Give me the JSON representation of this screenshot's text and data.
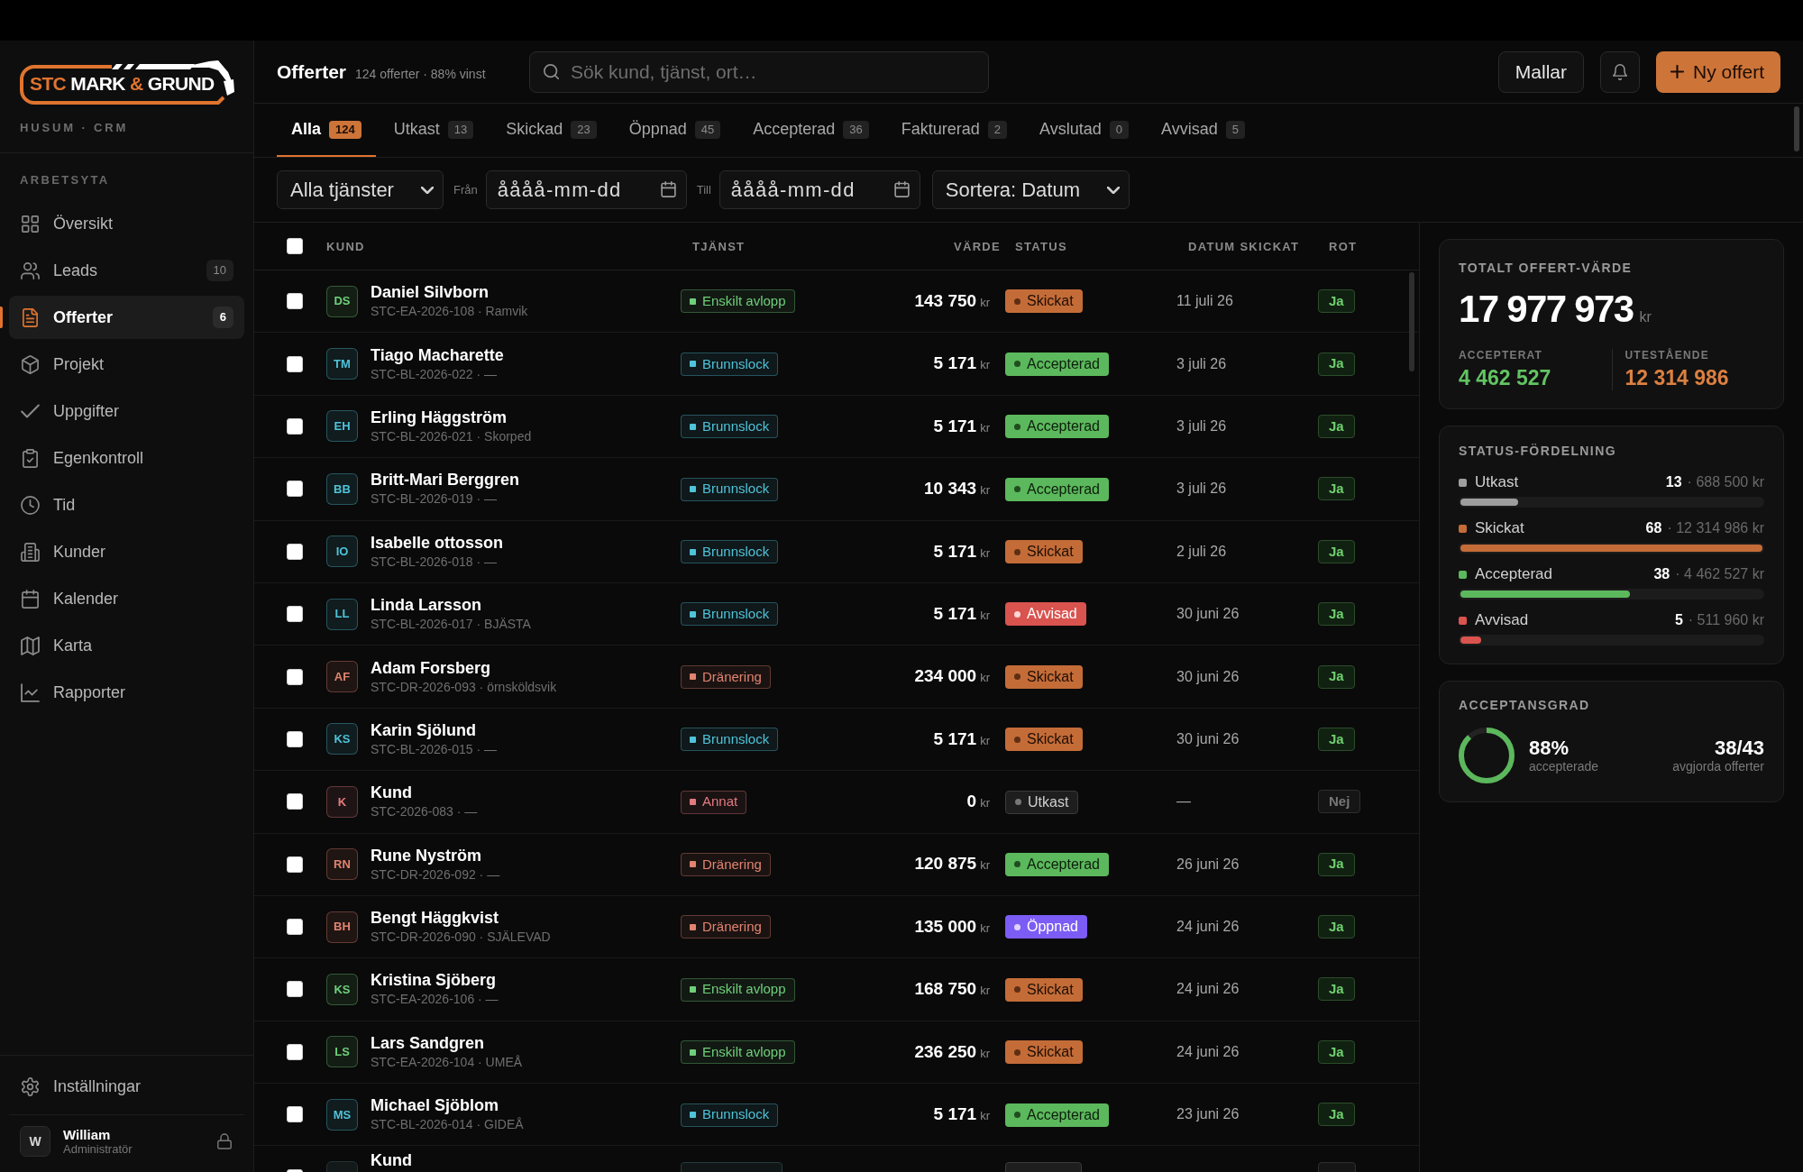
{
  "sidebar": {
    "logo": {
      "parts": [
        {
          "text": "STC",
          "accent": true
        },
        {
          "text": "MARK",
          "accent": false
        },
        {
          "text": "&",
          "accent": true
        },
        {
          "text": "GRUND",
          "accent": false
        }
      ]
    },
    "tagline": "HUSUM · CRM",
    "section": "ARBETSYTA",
    "items": [
      {
        "label": "Översikt",
        "selected": false
      },
      {
        "label": "Leads",
        "badge": "10",
        "selected": false
      },
      {
        "label": "Offerter",
        "badge": "6",
        "selected": true
      },
      {
        "label": "Projekt",
        "selected": false
      },
      {
        "label": "Uppgifter",
        "selected": false
      },
      {
        "label": "Egenkontroll",
        "selected": false
      },
      {
        "label": "Tid",
        "selected": false
      },
      {
        "label": "Kunder",
        "selected": false
      },
      {
        "label": "Kalender",
        "selected": false
      },
      {
        "label": "Karta",
        "selected": false
      },
      {
        "label": "Rapporter",
        "selected": false
      }
    ],
    "footer_item": {
      "label": "Inställningar"
    },
    "user": {
      "initial": "W",
      "name": "William",
      "role": "Administratör"
    }
  },
  "header": {
    "title": "Offerter",
    "subtitle": "124 offerter · 88% vinst",
    "search": {
      "placeholder": "Sök kund, tjänst, ort…"
    },
    "buttons": [
      {
        "kind": "secondary",
        "label": "Mallar"
      },
      {
        "kind": "notification"
      },
      {
        "kind": "primary",
        "label": "Ny offert"
      }
    ]
  },
  "tabs": [
    {
      "label": "Alla",
      "count": "124",
      "selected": true
    },
    {
      "label": "Utkast",
      "count": "13",
      "selected": false
    },
    {
      "label": "Skickad",
      "count": "23",
      "selected": false
    },
    {
      "label": "Öppnad",
      "count": "45",
      "selected": false
    },
    {
      "label": "Accepterad",
      "count": "36",
      "selected": false
    },
    {
      "label": "Fakturerad",
      "count": "2",
      "selected": false
    },
    {
      "label": "Avslutad",
      "count": "0",
      "selected": false
    },
    {
      "label": "Avvisad",
      "count": "5",
      "selected": false
    }
  ],
  "filters": [
    {
      "kind": "select",
      "value": "Alla tjänster"
    },
    {
      "kind": "date",
      "label": "Från",
      "placeholder": "åååå-mm-dd"
    },
    {
      "kind": "date",
      "label": "Till",
      "placeholder": "åååå-mm-dd"
    },
    {
      "kind": "select",
      "value": "Sortera: Datum"
    }
  ],
  "table": {
    "select_all": {
      "checked": false
    },
    "columns": [
      "KUND",
      "TJÄNST",
      "VÄRDE",
      "STATUS",
      "DATUM SKICKAT",
      "ROT"
    ],
    "rows": [
      {
        "checked": false,
        "initials": "DS",
        "name": "Daniel Silvborn",
        "reference": "STC-EA-2026-108 · Ramvik",
        "service": {
          "label": "Enskilt avlopp",
          "color": "#6fcf7a"
        },
        "value": "143 750",
        "currency": "kr",
        "status": {
          "label": "Skickat",
          "kind": "sent"
        },
        "date": "11 juli 26",
        "rot": {
          "label": "Ja",
          "on": true
        }
      },
      {
        "checked": false,
        "initials": "TM",
        "name": "Tiago Macharette",
        "reference": "STC-BL-2026-022 · —",
        "service": {
          "label": "Brunnslock",
          "color": "#4fc3d9"
        },
        "value": "5 171",
        "currency": "kr",
        "status": {
          "label": "Accepterad",
          "kind": "accepted"
        },
        "date": "3 juli 26",
        "rot": {
          "label": "Ja",
          "on": true
        }
      },
      {
        "checked": false,
        "initials": "EH",
        "name": "Erling Häggström",
        "reference": "STC-BL-2026-021 · Skorped",
        "service": {
          "label": "Brunnslock",
          "color": "#4fc3d9"
        },
        "value": "5 171",
        "currency": "kr",
        "status": {
          "label": "Accepterad",
          "kind": "accepted"
        },
        "date": "3 juli 26",
        "rot": {
          "label": "Ja",
          "on": true
        }
      },
      {
        "checked": false,
        "initials": "BB",
        "name": "Britt-Mari Berggren",
        "reference": "STC-BL-2026-019 · —",
        "service": {
          "label": "Brunnslock",
          "color": "#4fc3d9"
        },
        "value": "10 343",
        "currency": "kr",
        "status": {
          "label": "Accepterad",
          "kind": "accepted"
        },
        "date": "3 juli 26",
        "rot": {
          "label": "Ja",
          "on": true
        }
      },
      {
        "checked": false,
        "initials": "IO",
        "name": "Isabelle ottosson",
        "reference": "STC-BL-2026-018 · —",
        "service": {
          "label": "Brunnslock",
          "color": "#4fc3d9"
        },
        "value": "5 171",
        "currency": "kr",
        "status": {
          "label": "Skickat",
          "kind": "sent"
        },
        "date": "2 juli 26",
        "rot": {
          "label": "Ja",
          "on": true
        }
      },
      {
        "checked": false,
        "initials": "LL",
        "name": "Linda Larsson",
        "reference": "STC-BL-2026-017 · BJÄSTA",
        "service": {
          "label": "Brunnslock",
          "color": "#4fc3d9"
        },
        "value": "5 171",
        "currency": "kr",
        "status": {
          "label": "Avvisad",
          "kind": "rejected"
        },
        "date": "30 juni 26",
        "rot": {
          "label": "Ja",
          "on": true
        }
      },
      {
        "checked": false,
        "initials": "AF",
        "name": "Adam Forsberg",
        "reference": "STC-DR-2026-093 · örnsköldsvik",
        "service": {
          "label": "Dränering",
          "color": "#e2846f"
        },
        "value": "234 000",
        "currency": "kr",
        "status": {
          "label": "Skickat",
          "kind": "sent"
        },
        "date": "30 juni 26",
        "rot": {
          "label": "Ja",
          "on": true
        }
      },
      {
        "checked": false,
        "initials": "KS",
        "name": "Karin Sjölund",
        "reference": "STC-BL-2026-015 · —",
        "service": {
          "label": "Brunnslock",
          "color": "#4fc3d9"
        },
        "value": "5 171",
        "currency": "kr",
        "status": {
          "label": "Skickat",
          "kind": "sent"
        },
        "date": "30 juni 26",
        "rot": {
          "label": "Ja",
          "on": true
        }
      },
      {
        "checked": false,
        "initials": "K",
        "name": "Kund",
        "reference": "STC-2026-083 · —",
        "service": {
          "label": "Annat",
          "color": "#e27a80"
        },
        "value": "0",
        "currency": "kr",
        "status": {
          "label": "Utkast",
          "kind": "draft"
        },
        "date": "—",
        "rot": {
          "label": "Nej",
          "on": false
        }
      },
      {
        "checked": false,
        "initials": "RN",
        "name": "Rune Nyström",
        "reference": "STC-DR-2026-092 · —",
        "service": {
          "label": "Dränering",
          "color": "#e2846f"
        },
        "value": "120 875",
        "currency": "kr",
        "status": {
          "label": "Accepterad",
          "kind": "accepted"
        },
        "date": "26 juni 26",
        "rot": {
          "label": "Ja",
          "on": true
        }
      },
      {
        "checked": false,
        "initials": "BH",
        "name": "Bengt Häggkvist",
        "reference": "STC-DR-2026-090 · SJÄLEVAD",
        "service": {
          "label": "Dränering",
          "color": "#e2846f"
        },
        "value": "135 000",
        "currency": "kr",
        "status": {
          "label": "Öppnad",
          "kind": "opened"
        },
        "date": "24 juni 26",
        "rot": {
          "label": "Ja",
          "on": true
        }
      },
      {
        "checked": false,
        "initials": "KS",
        "name": "Kristina Sjöberg",
        "reference": "STC-EA-2026-106 · —",
        "service": {
          "label": "Enskilt avlopp",
          "color": "#6fcf7a"
        },
        "value": "168 750",
        "currency": "kr",
        "status": {
          "label": "Skickat",
          "kind": "sent"
        },
        "date": "24 juni 26",
        "rot": {
          "label": "Ja",
          "on": true
        }
      },
      {
        "checked": false,
        "initials": "LS",
        "name": "Lars Sandgren",
        "reference": "STC-EA-2026-104 · UMEÅ",
        "service": {
          "label": "Enskilt avlopp",
          "color": "#6fcf7a"
        },
        "value": "236 250",
        "currency": "kr",
        "status": {
          "label": "Skickat",
          "kind": "sent"
        },
        "date": "24 juni 26",
        "rot": {
          "label": "Ja",
          "on": true
        }
      },
      {
        "checked": false,
        "initials": "MS",
        "name": "Michael Sjöblom",
        "reference": "STC-BL-2026-014 · GIDEÅ",
        "service": {
          "label": "Brunnslock",
          "color": "#4fc3d9"
        },
        "value": "5 171",
        "currency": "kr",
        "status": {
          "label": "Accepterad",
          "kind": "accepted"
        },
        "date": "23 juni 26",
        "rot": {
          "label": "Ja",
          "on": true
        }
      },
      {
        "checked": false,
        "name": "Kund",
        "status": {
          "kind": "draft"
        },
        "rot": {
          "on": false
        }
      }
    ]
  },
  "summary": {
    "total": {
      "title": "TOTALT OFFERT-VÄRDE",
      "value": "17 977 973",
      "unit": "kr",
      "parts": [
        {
          "label": "ACCEPTERAT",
          "value": "4 462 527",
          "color": "#62c462"
        },
        {
          "label": "UTESTÅENDE",
          "value": "12 314 986",
          "color": "#db8040"
        }
      ]
    },
    "distribution": {
      "title": "STATUS-FÖRDELNING",
      "items": [
        {
          "label": "Utkast",
          "color": "#9e9e9e",
          "count": "13",
          "amount": "· 688 500 kr",
          "level": 0.19
        },
        {
          "label": "Skickat",
          "color": "#c46c38",
          "count": "68",
          "amount": "· 12 314 986 kr",
          "level": 1.0
        },
        {
          "label": "Accepterad",
          "color": "#5cb85c",
          "count": "38",
          "amount": "· 4 462 527 kr",
          "level": 0.56
        },
        {
          "label": "Avvisad",
          "color": "#d9534f",
          "count": "5",
          "amount": "· 511 960 kr",
          "level": 0.07
        }
      ]
    },
    "acceptance": {
      "title": "ACCEPTANSGRAD",
      "level": 0.88,
      "rate": "88%",
      "rate_label": "accepterade",
      "ratio": "38/43",
      "ratio_label": "avgjorda offerter"
    }
  }
}
